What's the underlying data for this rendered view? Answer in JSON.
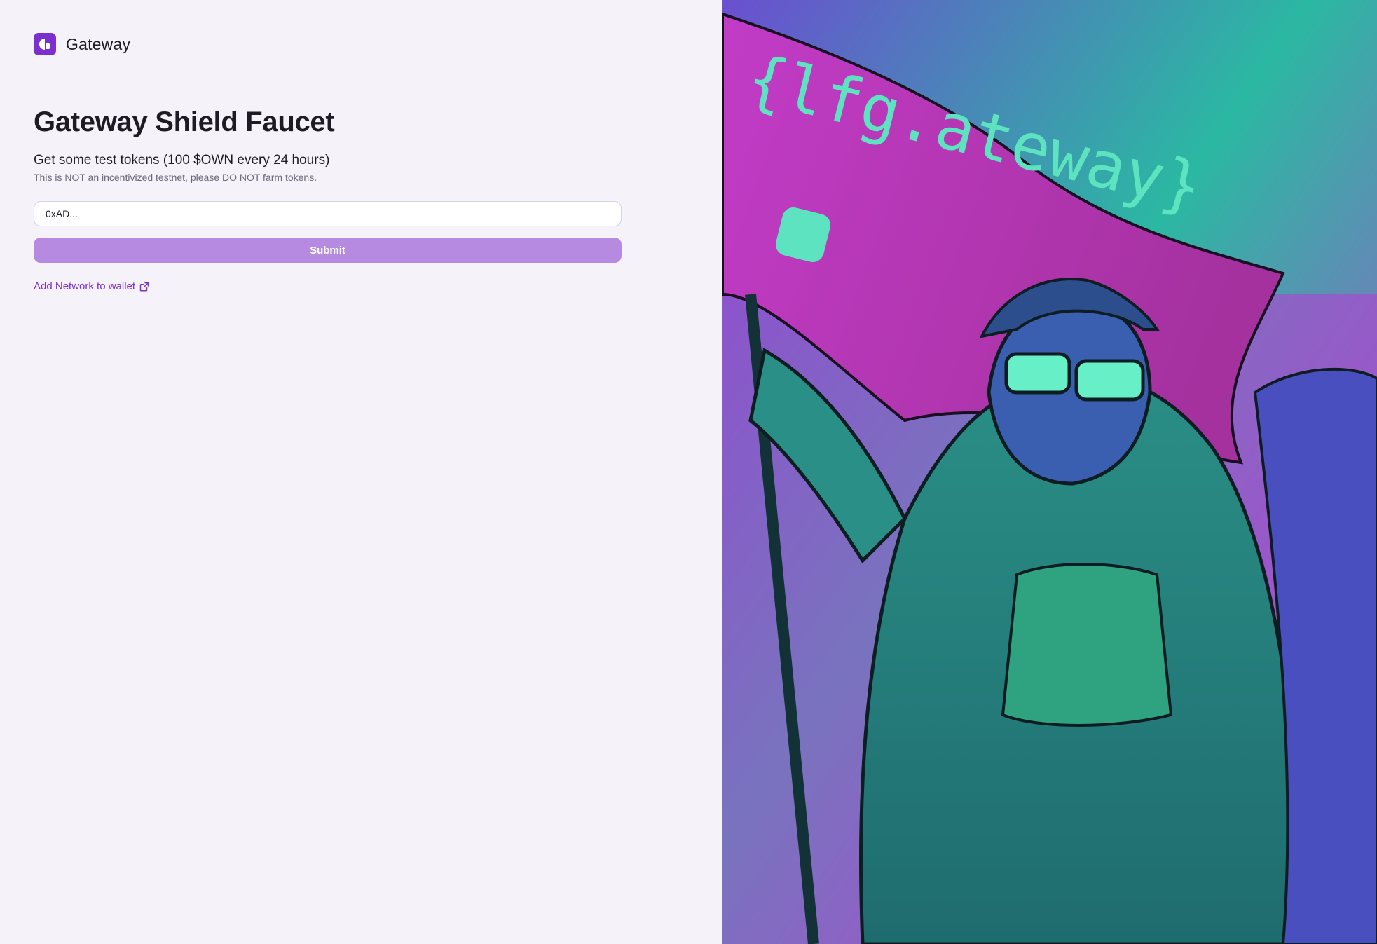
{
  "brand": {
    "name": "Gateway",
    "logo_icon": "gateway-logo-icon",
    "accent_color": "#7b2fcf"
  },
  "main": {
    "title": "Gateway Shield Faucet",
    "subtitle": "Get some test tokens (100 $OWN every 24 hours)",
    "note": "This is NOT an incentivized testnet, please DO NOT farm tokens.",
    "address_input": {
      "value": "0xAD...",
      "placeholder": "0xAD..."
    },
    "submit_label": "Submit",
    "submit_color": "#b78ae2",
    "add_network": {
      "label": "Add Network to wallet",
      "icon": "external-link-icon"
    }
  },
  "hero": {
    "description_icon": "hero-illustration",
    "flag_text": "{lfg.ateway}",
    "palette": [
      "#c438d8",
      "#2bb8a2",
      "#6b4fd0",
      "#67f0c8"
    ]
  }
}
